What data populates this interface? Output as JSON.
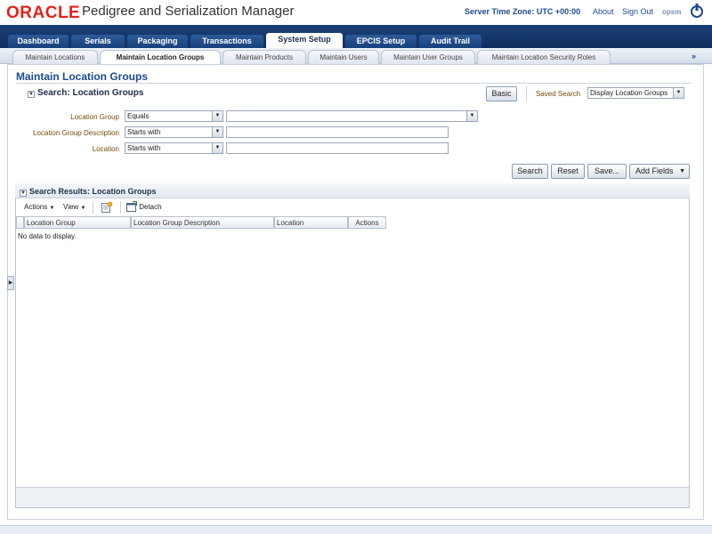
{
  "header": {
    "brand": "ORACLE",
    "app_title": "Pedigree and Serialization Manager",
    "server_time": "Server Time Zone: UTC +00:00",
    "about": "About",
    "sign_out": "Sign Out",
    "user": "opsm"
  },
  "main_tabs": [
    {
      "label": "Dashboard"
    },
    {
      "label": "Serials"
    },
    {
      "label": "Packaging"
    },
    {
      "label": "Transactions"
    },
    {
      "label": "System Setup",
      "selected": true
    },
    {
      "label": "EPCIS Setup"
    },
    {
      "label": "Audit Trail"
    }
  ],
  "sub_tabs": [
    {
      "label": "Maintain Locations"
    },
    {
      "label": "Maintain Location Groups",
      "selected": true
    },
    {
      "label": "Maintain Products"
    },
    {
      "label": "Maintain Users"
    },
    {
      "label": "Maintain User Groups"
    },
    {
      "label": "Maintain Location Security Roles"
    }
  ],
  "more_tabs": "»",
  "page": {
    "title": "Maintain Location Groups"
  },
  "search": {
    "heading": "Search: Location Groups",
    "basic_button": "Basic",
    "saved_search_label": "Saved Search",
    "saved_search_value": "Display Location Groups",
    "fields": [
      {
        "label": "Location Group",
        "operator": "Equals",
        "value": ""
      },
      {
        "label": "Location Group Description",
        "operator": "Starts with",
        "value": ""
      },
      {
        "label": "Location",
        "operator": "Starts with",
        "value": ""
      }
    ],
    "buttons": {
      "search": "Search",
      "reset": "Reset",
      "save": "Save...",
      "add_fields": "Add Fields"
    }
  },
  "results": {
    "heading": "Search Results: Location Groups",
    "toolbar": {
      "actions": "Actions",
      "view": "View",
      "detach": "Detach"
    },
    "columns": [
      "Location Group",
      "Location Group Description",
      "Location",
      "Actions"
    ],
    "rows": [],
    "empty_text": "No data to display."
  },
  "colors": {
    "brand_red": "#e2231a",
    "nav_blue": "#1a3f78",
    "link_blue": "#1d4b8f",
    "label_brown": "#7a4b0c"
  },
  "icons": [
    "signout-icon",
    "disclosure-icon",
    "new-row-icon",
    "detach-icon",
    "dropdown-arrow-icon"
  ]
}
